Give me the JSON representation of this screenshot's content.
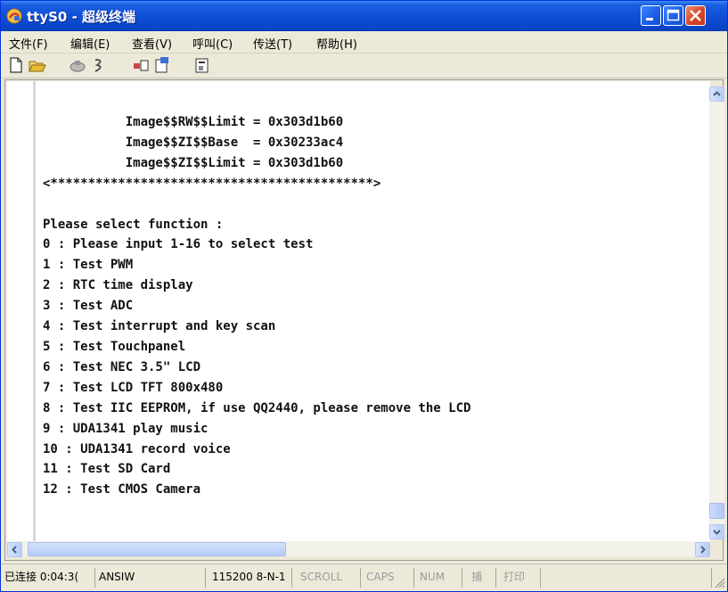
{
  "window": {
    "title": "ttyS0 - 超级终端"
  },
  "menu": [
    "文件(F)",
    "编辑(E)",
    "查看(V)",
    "呼叫(C)",
    "传送(T)",
    "帮助(H)"
  ],
  "toolbar": [
    "new-icon",
    "open-icon",
    "disconnect-icon",
    "dial-icon",
    "send-icon",
    "receive-icon",
    "properties-icon"
  ],
  "terminal": {
    "lines": [
      "           Image$$RW$$Limit = 0x303d1b60",
      "           Image$$ZI$$Base  = 0x30233ac4",
      "           Image$$ZI$$Limit = 0x303d1b60",
      "<*******************************************>",
      "",
      "Please select function :",
      "0 : Please input 1-16 to select test",
      "1 : Test PWM",
      "2 : RTC time display",
      "3 : Test ADC",
      "4 : Test interrupt and key scan",
      "5 : Test Touchpanel",
      "6 : Test NEC 3.5\" LCD",
      "7 : Test LCD TFT 800x480",
      "8 : Test IIC EEPROM, if use QQ2440, please remove the LCD",
      "9 : UDA1341 play music",
      "10 : UDA1341 record voice",
      "11 : Test SD Card",
      "12 : Test CMOS Camera"
    ]
  },
  "status": {
    "connected": "已连接 0:04:3(",
    "emulation": "ANSIW",
    "port": "115200 8-N-1",
    "scroll": "SCROLL",
    "caps": "CAPS",
    "num": "NUM",
    "capture": "捕",
    "print": "打印"
  },
  "colors": {
    "titlebar": "#0f4fd6",
    "close_button": "#d5462a",
    "chrome": "#ece9d8"
  }
}
